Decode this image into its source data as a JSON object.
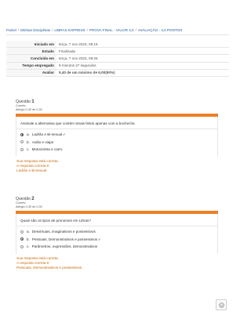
{
  "breadcrumb": {
    "items": [
      "Painel",
      "Minhas Disciplinas",
      "LIBRAS EXPRESS",
      "PROVA FINAL - VALOR 4,0",
      "AVALIAÇÃO - 4,0 PONTOS"
    ],
    "separator": "/"
  },
  "summary": {
    "rows": [
      {
        "label": "Iniciado em",
        "value": "terça, 7 nov 2023, 09:16"
      },
      {
        "label": "Estado",
        "value": "Finalizada"
      },
      {
        "label": "Concluída em",
        "value": "terça, 7 nov 2023, 09:25"
      },
      {
        "label": "Tempo empregado",
        "value": "9 minutos 27 segundos"
      },
      {
        "label": "Avaliar",
        "value": "5,40 de um máximo de 6,00(90%)"
      }
    ]
  },
  "questions": [
    {
      "label": "Questão",
      "number": "1",
      "status": "Correto",
      "flag": "Atingiu 0,30 de 0,30",
      "text": "Assinale a alternativa que contém sinais feitos apenas com a bochecha",
      "options": [
        {
          "letter": "a.",
          "text": "Ladrão e Bi-sexual",
          "checked": true,
          "correct_mark": true
        },
        {
          "letter": "b.",
          "text": "Avião e viajar",
          "checked": false,
          "correct_mark": false
        },
        {
          "letter": "c.",
          "text": "Motocicleta e carro",
          "checked": false,
          "correct_mark": false
        }
      ],
      "feedback_line1": "Sua resposta está correta.",
      "feedback_line2": "A resposta correta é:",
      "feedback_line3": "Ladrão e Bi-sexual"
    },
    {
      "label": "Questão",
      "number": "2",
      "status": "Correto",
      "flag": "Atingiu 0,30 de 0,30",
      "text": "Quais são os tipos de pronomes em Libras?",
      "options": [
        {
          "letter": "a.",
          "text": "Desvirtuais, imaginativos e possessivos",
          "checked": false,
          "correct_mark": false
        },
        {
          "letter": "b.",
          "text": "Pessoais, Demonstrativos e possessivos",
          "checked": true,
          "correct_mark": true
        },
        {
          "letter": "c.",
          "text": "Parâmetros, expressões, demonstrativos",
          "checked": false,
          "correct_mark": false
        }
      ],
      "feedback_line1": "Sua resposta está correta.",
      "feedback_line2": "A resposta correta é:",
      "feedback_line3": "Pessoais, Demonstrativos e possessivos"
    }
  ],
  "floating_button": {
    "icon": "chat-icon"
  },
  "colors": {
    "accent": "#ee7f25",
    "feedback": "#c66a0e",
    "link": "#1f5a9e"
  }
}
